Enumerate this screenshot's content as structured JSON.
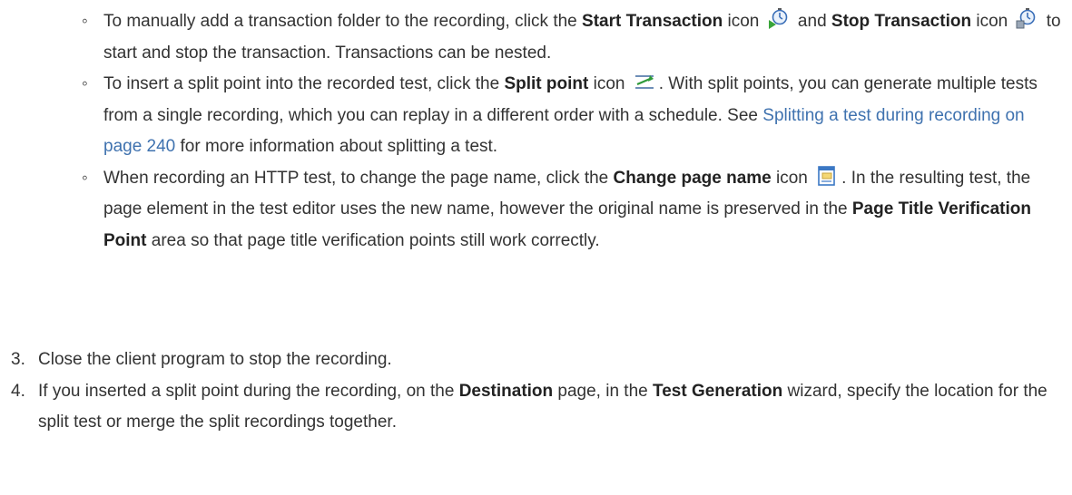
{
  "sub_items": [
    {
      "p1": "To manually add a transaction folder to the recording, click the ",
      "b1": "Start Transaction",
      "p2": " icon ",
      "p3": " and ",
      "b2": "Stop Transaction",
      "p4": " icon ",
      "p5": " to start and stop the transaction. Transactions can be nested."
    },
    {
      "p1": "To insert a split point into the recorded test, click the ",
      "b1": "Split point",
      "p2": " icon ",
      "p3": ". With split points, you can generate multiple tests from a single recording, which you can replay in a different order with a schedule. See ",
      "link": "Splitting a test during recording on page 240",
      "p4": " for more information about splitting a test."
    },
    {
      "p1": "When recording an HTTP test, to change the page name, click the ",
      "b1": "Change page name",
      "p2": " icon ",
      "p3": ". In the resulting test, the page element in the test editor uses the new name, however the original name is preserved in the ",
      "b2": "Page Title Verification Point",
      "p4": " area so that page title verification points still work correctly."
    }
  ],
  "steps": [
    {
      "num": "3.",
      "p1": "Close the client program to stop the recording."
    },
    {
      "num": "4.",
      "p1": "If you inserted a split point during the recording, on the ",
      "b1": "Destination",
      "p2": " page, in the ",
      "b2": "Test Generation",
      "p3": " wizard, specify the location for the split test or merge the split recordings together."
    }
  ],
  "icons": [
    "start-transaction-icon",
    "stop-transaction-icon",
    "split-point-icon",
    "change-page-name-icon"
  ],
  "colors": {
    "text": "#333333",
    "link": "#3f72af"
  }
}
